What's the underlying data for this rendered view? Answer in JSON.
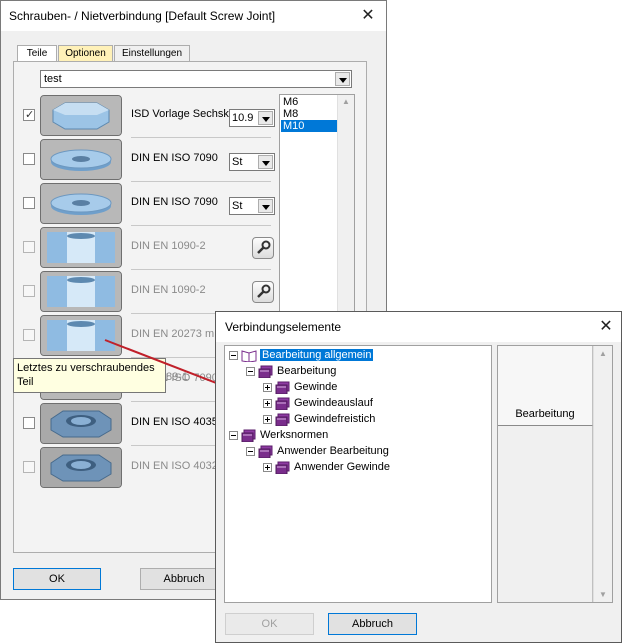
{
  "main_window": {
    "title": "Schrauben- / Nietverbindung [Default Screw Joint]",
    "tabs": [
      {
        "label": "Teile",
        "active": true
      },
      {
        "label": "Optionen",
        "active": false
      },
      {
        "label": "Einstellungen",
        "active": false
      }
    ],
    "preset_combo": {
      "value": "test"
    },
    "rows": [
      {
        "checked": true,
        "enabled": true,
        "label": "ISD Vorlage Sechsk",
        "thumb": "hex-nut",
        "select": "10.9"
      },
      {
        "checked": false,
        "enabled": true,
        "label": "DIN EN ISO 7090",
        "thumb": "washer",
        "select": "St"
      },
      {
        "checked": false,
        "enabled": true,
        "label": "DIN EN ISO 7090",
        "thumb": "washer",
        "select": "St"
      },
      {
        "checked": false,
        "enabled": false,
        "label": "DIN EN 1090-2",
        "thumb": "bore",
        "tool": "wrench-icon"
      },
      {
        "checked": false,
        "enabled": false,
        "label": "DIN EN 1090-2",
        "thumb": "bore",
        "tool": "wrench-icon"
      },
      {
        "checked": false,
        "enabled": false,
        "label": "DIN EN 20273 m",
        "thumb": "bore"
      },
      {
        "checked": false,
        "enabled": false,
        "label": "DIN EN ISO 7090",
        "thumb": "washer"
      },
      {
        "checked": false,
        "enabled": true,
        "label": "DIN EN ISO 4035",
        "thumb": "hex-nut-dark"
      },
      {
        "checked": false,
        "enabled": false,
        "label": "DIN EN ISO 4032",
        "thumb": "hex-nut-dark"
      }
    ],
    "hidden_row_fragment": "89-1",
    "size_list": {
      "items": [
        "M6",
        "M8",
        "M10"
      ],
      "selected": "M10"
    },
    "tooltip": {
      "line1": "Letztes zu verschraubendes",
      "line2": "Teil"
    },
    "buttons": {
      "ok": "OK",
      "cancel": "Abbruch"
    }
  },
  "dialog": {
    "title": "Verbindungselemente",
    "tree": [
      {
        "label": "Bearbeitung allgemein",
        "level": 0,
        "expander": "minus",
        "icon": "open-book-icon",
        "selected": true
      },
      {
        "label": "Bearbeitung",
        "level": 1,
        "expander": "minus",
        "icon": "book-icon"
      },
      {
        "label": "Gewinde",
        "level": 2,
        "expander": "plus",
        "icon": "book-icon"
      },
      {
        "label": "Gewindeauslauf",
        "level": 2,
        "expander": "plus",
        "icon": "book-icon"
      },
      {
        "label": "Gewindefreistich",
        "level": 2,
        "expander": "plus",
        "icon": "book-icon"
      },
      {
        "label": "Werksnormen",
        "level": 0,
        "expander": "minus",
        "icon": "book-icon"
      },
      {
        "label": "Anwender Bearbeitung",
        "level": 1,
        "expander": "minus",
        "icon": "book-icon"
      },
      {
        "label": "Anwender Gewinde",
        "level": 2,
        "expander": "plus",
        "icon": "book-icon"
      }
    ],
    "right_panel_header": "Bearbeitung",
    "buttons": {
      "ok": "OK",
      "cancel": "Abbruch"
    }
  },
  "colors": {
    "accent": "#0078d7",
    "tab_optionen": "#fff1b8",
    "book": "#7a2d8c",
    "arrow": "#c0202a"
  }
}
